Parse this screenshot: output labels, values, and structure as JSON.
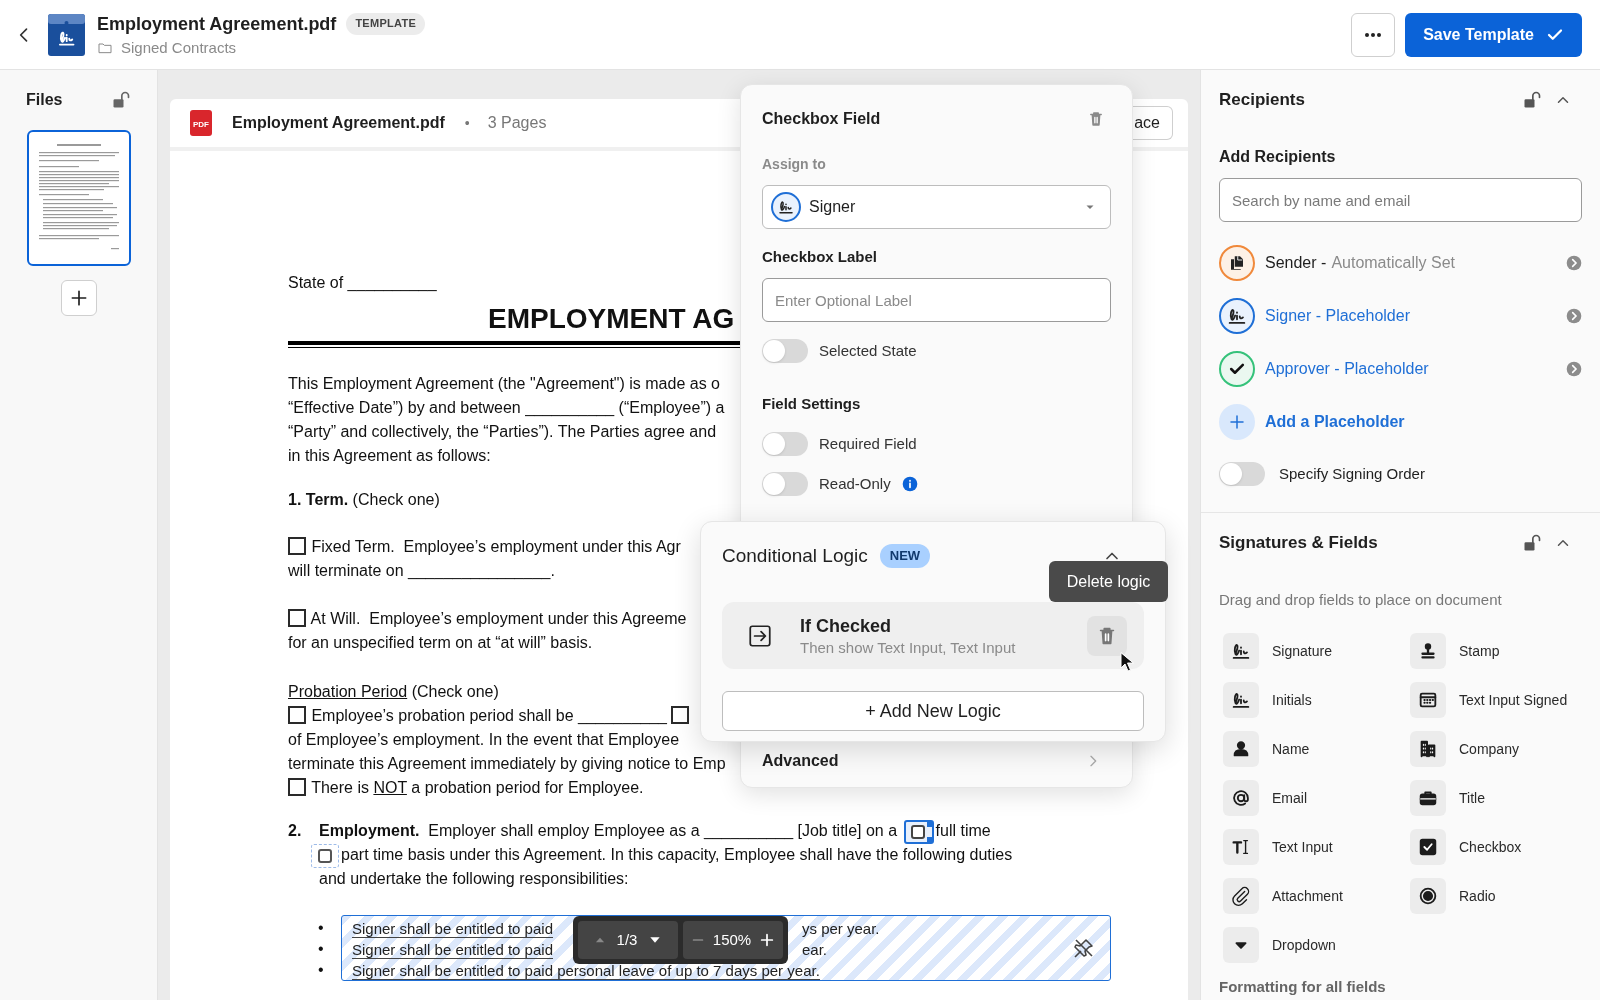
{
  "header": {
    "title": "Employment Agreement.pdf",
    "badge": "TEMPLATE",
    "folder": "Signed Contracts",
    "save_button": "Save Template"
  },
  "files": {
    "title": "Files",
    "pages": [
      {
        "selected": true
      }
    ]
  },
  "document": {
    "file_type": "PDF",
    "name": "Employment Agreement.pdf",
    "separator": "•",
    "pages": "3 Pages",
    "replace_button": "ace",
    "blocks": [
      {
        "kind": "paragraph",
        "lines": [
          [
            {
              "kind": "text",
              "text": "State of __________"
            }
          ]
        ]
      },
      {
        "kind": "heading",
        "text": "EMPLOYMENT AG"
      },
      {
        "kind": "paragraph",
        "lines": [
          [
            {
              "kind": "text",
              "text": "This Employment Agreement (the \"Agreement\") is made as o"
            }
          ],
          [
            {
              "kind": "text",
              "text": "“Effective Date”) by and between __________ (“Employee”) a"
            }
          ],
          [
            {
              "kind": "text",
              "text": "“Party” and collectively, the “Parties”). The Parties agree and"
            }
          ],
          [
            {
              "kind": "text",
              "text": "in this Agreement as follows:"
            }
          ]
        ]
      },
      {
        "kind": "paragraph",
        "lines": [
          [
            {
              "kind": "bold",
              "text": "1. Term."
            },
            {
              "kind": "text",
              "text": " (Check one)"
            }
          ]
        ]
      },
      {
        "kind": "paragraph",
        "lines": [
          [
            {
              "kind": "box"
            },
            {
              "kind": "text",
              "text": " Fixed Term.  Employee’s employment under this Agr"
            }
          ],
          [
            {
              "kind": "text",
              "text": "will terminate on ________________."
            }
          ]
        ]
      },
      {
        "kind": "paragraph",
        "lines": [
          [
            {
              "kind": "box"
            },
            {
              "kind": "text",
              "text": " At Will.  Employee’s employment under this Agreeme"
            }
          ],
          [
            {
              "kind": "text",
              "text": "for an unspecified term on at “at will” basis."
            }
          ]
        ]
      },
      {
        "kind": "paragraph",
        "lines": [
          [
            {
              "kind": "underline",
              "text": "Probation Period"
            },
            {
              "kind": "text",
              "text": " (Check one)"
            }
          ],
          [
            {
              "kind": "box"
            },
            {
              "kind": "text",
              "text": " Employee’s probation period shall be __________ "
            },
            {
              "kind": "box"
            }
          ],
          [
            {
              "kind": "text",
              "text": "of Employee’s employment. In the event that Employee"
            }
          ],
          [
            {
              "kind": "text",
              "text": "terminate this Agreement immediately by giving notice to Emp"
            }
          ],
          [
            {
              "kind": "box"
            },
            {
              "kind": "text",
              "text": " There is "
            },
            {
              "kind": "underline",
              "text": "NOT"
            },
            {
              "kind": "text",
              "text": " a probation period for Employee."
            }
          ]
        ]
      },
      {
        "kind": "numbered",
        "number": "2.",
        "lines": [
          [
            {
              "kind": "bold",
              "text": "Employment."
            },
            {
              "kind": "text",
              "text": "  Employer shall employ Employee as a __________ [Job title] on a "
            },
            {
              "kind": "focused"
            },
            {
              "kind": "text",
              "text": "full time"
            }
          ],
          [
            {
              "kind": "field"
            },
            {
              "kind": "text",
              "text": "part time basis under this Agreement. In this capacity, Employee shall have the following duties"
            }
          ],
          [
            {
              "kind": "text",
              "text": "and undertake the following responsibilities:"
            }
          ]
        ]
      },
      {
        "kind": "input_field",
        "lines": [
          {
            "bullet": "•",
            "before": "Signer shall be entitled to paid",
            "after": "ys per year."
          },
          {
            "bullet": "•",
            "before": "Signer shall be entitled to paid",
            "after": "ear."
          },
          {
            "bullet": "•",
            "text": "Signer shall be entitled to paid personal leave of up to 7 days per year."
          }
        ]
      }
    ]
  },
  "toolbar": {
    "page": "1/3",
    "zoom": "150%"
  },
  "field_panel": {
    "title": "Checkbox Field",
    "assign_label": "Assign to",
    "assignee": "Signer",
    "label_title": "Checkbox Label",
    "label_placeholder": "Enter Optional Label",
    "toggles": [
      {
        "label": "Selected State",
        "on": false
      }
    ],
    "settings_title": "Field Settings",
    "settings": [
      {
        "label": "Required Field",
        "on": false,
        "info": false
      },
      {
        "label": "Read-Only",
        "on": false,
        "info": true
      }
    ],
    "advanced": "Advanced"
  },
  "logic_panel": {
    "title": "Conditional Logic",
    "badge": "NEW",
    "rules": [
      {
        "title": "If Checked",
        "detail": "Then show Text Input, Text Input"
      }
    ],
    "add_button": "+ Add New Logic",
    "tooltip": "Delete logic"
  },
  "recipients": {
    "title": "Recipients",
    "add_title": "Add Recipients",
    "search_placeholder": "Search by name and email",
    "items": [
      {
        "kind": "sender",
        "label": "Sender -",
        "detail": "Automatically Set",
        "color": "#f0893b"
      },
      {
        "kind": "signer",
        "label": "Signer - Placeholder",
        "color": "#1f6fd6"
      },
      {
        "kind": "approver",
        "label": "Approver - Placeholder",
        "color": "#35c27a"
      }
    ],
    "add_button": "Add a Placeholder",
    "signing_order": {
      "label": "Specify Signing Order",
      "on": false
    }
  },
  "fields": {
    "title": "Signatures & Fields",
    "hint": "Drag and drop fields to place on document",
    "items": [
      {
        "kind": "signature",
        "label": "Signature"
      },
      {
        "kind": "stamp",
        "label": "Stamp"
      },
      {
        "kind": "initials",
        "label": "Initials"
      },
      {
        "kind": "date",
        "label": "Text Input Signed"
      },
      {
        "kind": "name",
        "label": "Name"
      },
      {
        "kind": "company",
        "label": "Company"
      },
      {
        "kind": "email",
        "label": "Email"
      },
      {
        "kind": "title",
        "label": "Title"
      },
      {
        "kind": "text",
        "label": "Text Input"
      },
      {
        "kind": "checkbox",
        "label": "Checkbox"
      },
      {
        "kind": "attachment",
        "label": "Attachment"
      },
      {
        "kind": "radio",
        "label": "Radio"
      },
      {
        "kind": "dropdown",
        "label": "Dropdown"
      }
    ],
    "formatting_title": "Formatting for all fields"
  }
}
